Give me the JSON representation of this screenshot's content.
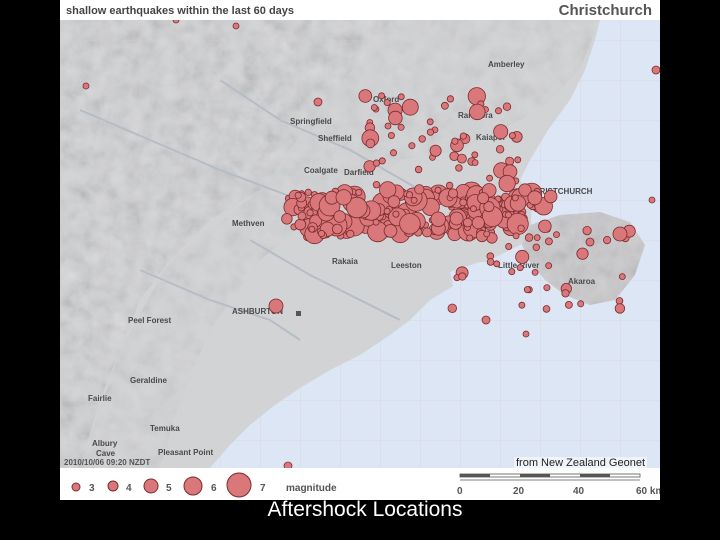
{
  "header": {
    "title": "shallow earthquakes within the last 60 days",
    "region": "Christchurch"
  },
  "credit": "from New Zealand Geonet",
  "timestamp": "2010/10/06 09:20 NZDT",
  "caption": "Aftershock Locations",
  "legend": {
    "magnitudes": [
      "3",
      "4",
      "5",
      "6",
      "7"
    ],
    "title": "magnitude"
  },
  "scale": {
    "ticks": [
      "0",
      "20",
      "40",
      "60 km"
    ]
  },
  "places": [
    "Amberley",
    "Oxford",
    "Rangiora",
    "Springfield",
    "Kaiapoi",
    "Sheffield",
    "Coalgate",
    "Darfield",
    "CHRISTCHURCH",
    "Methven",
    "Rakaia",
    "Leeston",
    "Little River",
    "Akaroa",
    "ASHBURTON",
    "Peel Forest",
    "Geraldine",
    "Fairlie",
    "Temuka",
    "Albury",
    "Cave",
    "Pleasant Point"
  ],
  "colors": {
    "sea": "#dce6f5",
    "land": "#d4d4d4",
    "quake_fill": "#d9777a",
    "quake_stroke": "#7a2b2e"
  }
}
